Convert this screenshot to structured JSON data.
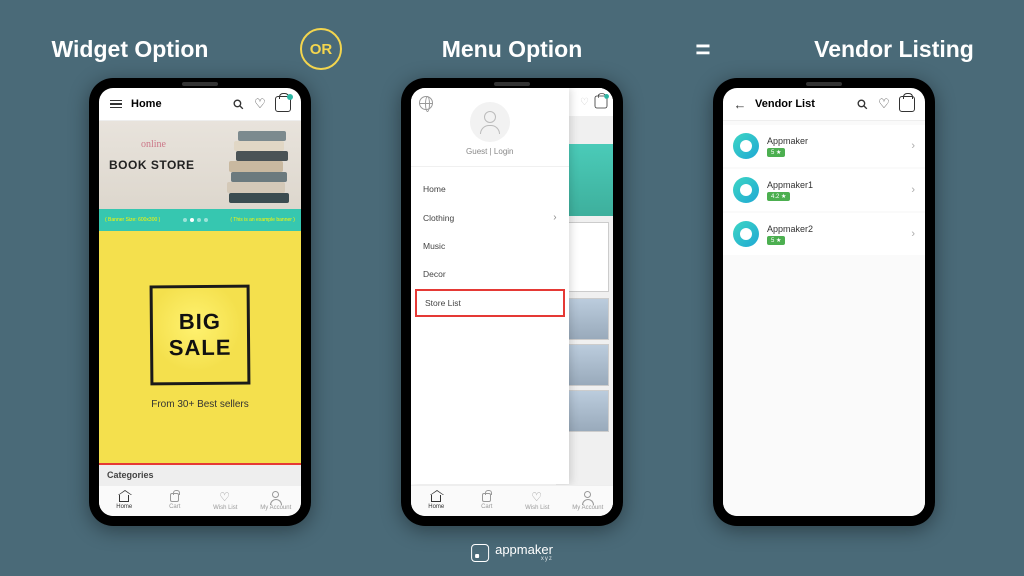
{
  "headers": {
    "widget": "Widget Option",
    "or": "OR",
    "menu": "Menu Option",
    "eq": "=",
    "vendor": "Vendor Listing"
  },
  "phone1": {
    "topbar_title": "Home",
    "hero_script": "online",
    "hero_text": "BOOK STORE",
    "banner_left": "( Banner Size: 600x300 )",
    "banner_right": "( This is an example banner )",
    "sale_big": "BIG",
    "sale_sale": "SALE",
    "sale_sub": "From 30+ Best sellers",
    "categories": "Categories",
    "nav": {
      "home": "Home",
      "cart": "Cart",
      "wish": "Wish List",
      "account": "My Account"
    }
  },
  "phone2": {
    "guest": "Guest",
    "login": "Login",
    "menu": {
      "home": "Home",
      "clothing": "Clothing",
      "music": "Music",
      "decor": "Decor",
      "store_list": "Store List"
    },
    "nav": {
      "home": "Home",
      "cart": "Cart",
      "wish": "Wish List",
      "account": "My Account"
    }
  },
  "phone3": {
    "title": "Vendor List",
    "vendors": [
      {
        "name": "Appmaker",
        "rating": "5 ★"
      },
      {
        "name": "Appmaker1",
        "rating": "4.2 ★"
      },
      {
        "name": "Appmaker2",
        "rating": "5 ★"
      }
    ]
  },
  "footer": {
    "brand": "appmaker",
    "sub": "xyz"
  }
}
